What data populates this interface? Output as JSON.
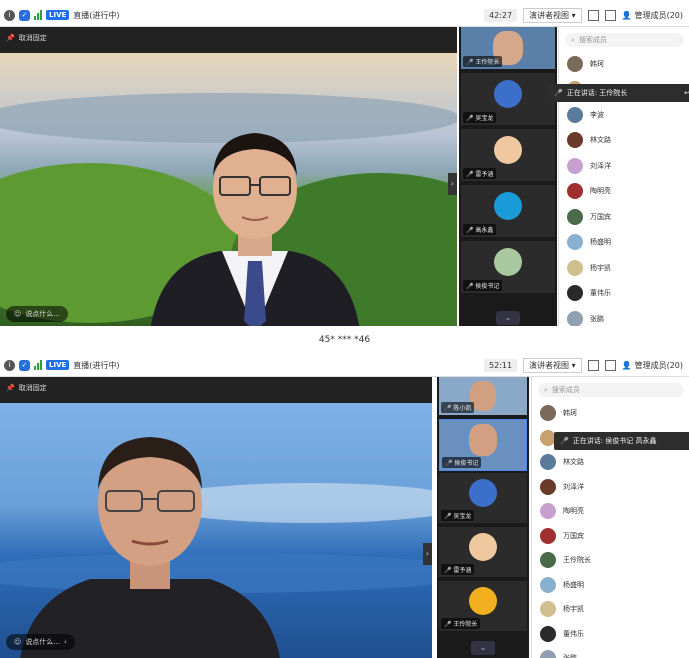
{
  "panels": [
    {
      "strip": "",
      "status": {
        "live_label": "LIVE",
        "stream_status": "直播(进行中)"
      },
      "timer": "42:27",
      "view_label": "演讲者视图",
      "manage_label": "管理成员(20)",
      "pin_label": "取消固定",
      "say_placeholder": "说点什么...",
      "thumbs": [
        "王伶院长",
        "吴宝龙",
        "雷予涵",
        "高永鑫",
        "侯俊书记"
      ],
      "search_placeholder": "搜索成员",
      "tip": "正在讲话: 王伶院长",
      "members": [
        "韩珂",
        "侯俊书记",
        "李波",
        "林文路",
        "刘泽洋",
        "陶明亮",
        "万国宾",
        "杨盛明",
        "杨宇凯",
        "董伟乐",
        "张鹏"
      ]
    },
    {
      "strip": "45* *** *46",
      "status": {
        "live_label": "LIVE",
        "stream_status": "直播(进行中)"
      },
      "timer": "52:11",
      "view_label": "演讲者视图",
      "manage_label": "管理成员(20)",
      "pin_label": "取消固定",
      "say_placeholder": "说点什么...",
      "thumbs": [
        "陈小凯",
        "侯俊书记",
        "吴宝龙",
        "雷予涵",
        "王伶院长"
      ],
      "search_placeholder": "搜索成员",
      "tip": "正在讲话: 侯俊书记 高永鑫",
      "members": [
        "韩珂",
        "李波",
        "林文路",
        "刘泽洋",
        "陶明亮",
        "万国宾",
        "王伶院长",
        "杨盛明",
        "杨宇凯",
        "董伟乐",
        "张鹏"
      ]
    }
  ],
  "colors": {
    "accent": "#1f6feb",
    "live": "#1f6feb",
    "signal": "#2ea043"
  },
  "icons": [
    "info-icon",
    "shield-icon",
    "signal-icon",
    "pin-icon",
    "mic-icon",
    "search-icon",
    "chevron-down-icon",
    "fullscreen-icon",
    "layout-icon",
    "people-icon"
  ]
}
